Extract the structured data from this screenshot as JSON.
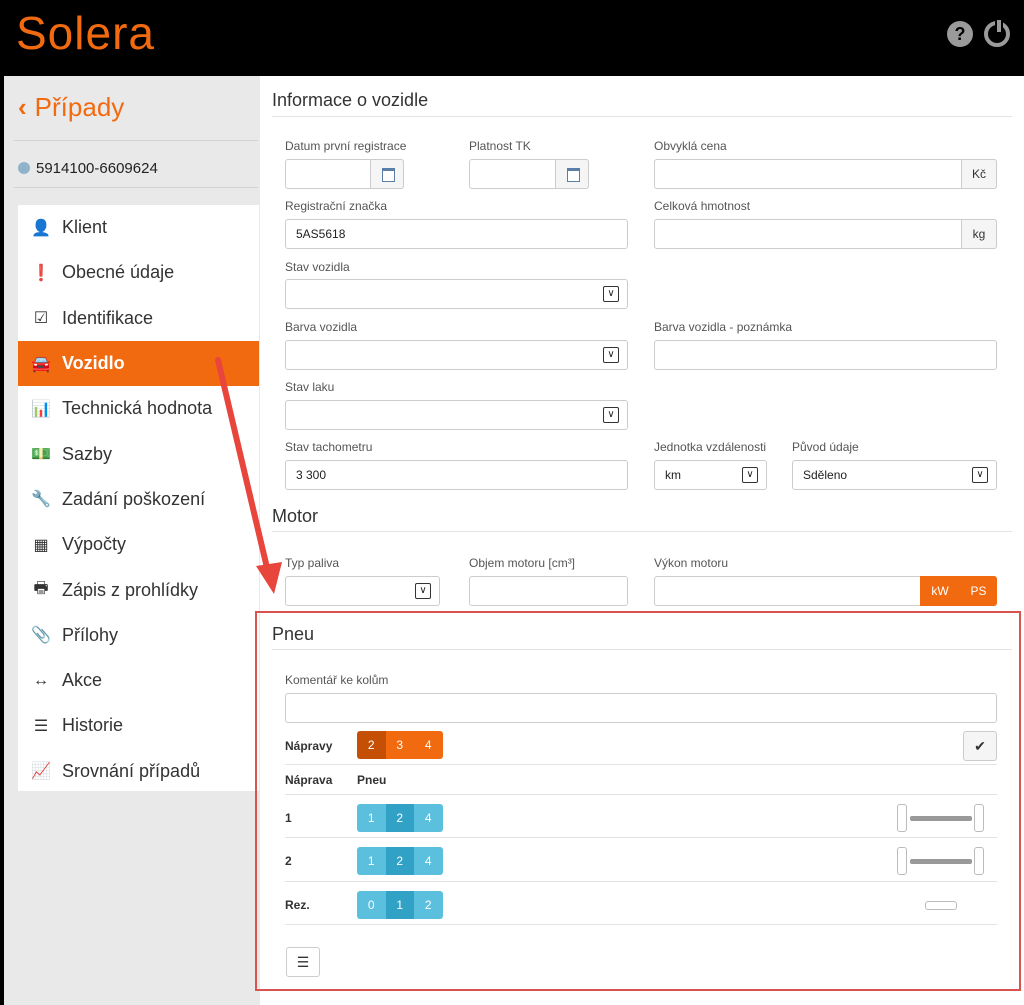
{
  "app": {
    "logo": "Solera"
  },
  "header": {
    "help_icon": "question-circle-icon",
    "power_icon": "power-icon"
  },
  "sidebar": {
    "back_label": "Případy",
    "case_id": "5914100-6609624",
    "items": [
      {
        "label": "Klient",
        "icon": "user-icon",
        "glyph": "👤"
      },
      {
        "label": "Obecné údaje",
        "icon": "exclamation-icon",
        "glyph": "❗"
      },
      {
        "label": "Identifikace",
        "icon": "checkbox-icon",
        "glyph": "☑"
      },
      {
        "label": "Vozidlo",
        "icon": "car-icon",
        "glyph": "🚘",
        "active": true
      },
      {
        "label": "Technická hodnota",
        "icon": "bar-chart-icon",
        "glyph": "📊"
      },
      {
        "label": "Sazby",
        "icon": "money-icon",
        "glyph": "💵"
      },
      {
        "label": "Zadání poškození",
        "icon": "wrench-icon",
        "glyph": "🔧"
      },
      {
        "label": "Výpočty",
        "icon": "calculator-icon",
        "glyph": "▦"
      },
      {
        "label": "Zápis z prohlídky",
        "icon": "printer-icon",
        "glyph": "🖶"
      },
      {
        "label": "Přílohy",
        "icon": "paperclip-icon",
        "glyph": "📎"
      },
      {
        "label": "Akce",
        "icon": "arrows-horizontal-icon",
        "glyph": "↔"
      },
      {
        "label": "Historie",
        "icon": "list-icon",
        "glyph": "☰"
      },
      {
        "label": "Srovnání případů",
        "icon": "line-chart-icon",
        "glyph": "📈"
      }
    ]
  },
  "vehicle": {
    "title": "Informace o vozidle",
    "first_registration_label": "Datum první registrace",
    "first_registration_value": "",
    "tk_validity_label": "Platnost TK",
    "tk_validity_value": "",
    "usual_price_label": "Obvyklá cena",
    "usual_price_value": "",
    "usual_price_unit": "Kč",
    "registration_label": "Registrační značka",
    "registration_value": "5AS5618",
    "total_weight_label": "Celková hmotnost",
    "total_weight_value": "",
    "total_weight_unit": "kg",
    "state_label": "Stav vozidla",
    "state_value": "",
    "color_label": "Barva vozidla",
    "color_value": "",
    "color_note_label": "Barva vozidla - poznámka",
    "color_note_value": "",
    "paint_state_label": "Stav laku",
    "paint_state_value": "",
    "odometer_label": "Stav tachometru",
    "odometer_value": "3 300",
    "distance_unit_label": "Jednotka vzdálenosti",
    "distance_unit_value": "km",
    "origin_label": "Původ údaje",
    "origin_value": "Sděleno"
  },
  "engine": {
    "title": "Motor",
    "fuel_label": "Typ paliva",
    "fuel_value": "",
    "volume_label": "Objem motoru [cm³]",
    "volume_value": "",
    "power_label": "Výkon motoru",
    "power_value": "",
    "unit_kw": "kW",
    "unit_ps": "PS"
  },
  "tires": {
    "title": "Pneu",
    "comment_label": "Komentář ke kolům",
    "comment_value": "",
    "axles_label": "Nápravy",
    "axles_options": [
      "2",
      "3",
      "4"
    ],
    "axles_selected": "2",
    "col_axle": "Náprava",
    "col_tire": "Pneu",
    "rows": [
      {
        "label": "1",
        "options": [
          "1",
          "2",
          "4"
        ],
        "selected": "2"
      },
      {
        "label": "2",
        "options": [
          "1",
          "2",
          "4"
        ],
        "selected": "2"
      },
      {
        "label": "Rez.",
        "options": [
          "0",
          "1",
          "2"
        ],
        "selected": "1"
      }
    ]
  }
}
